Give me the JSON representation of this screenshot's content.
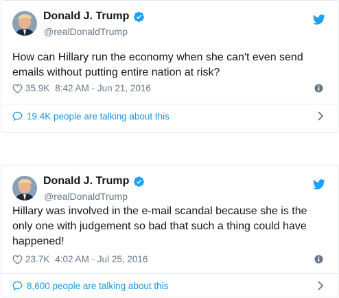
{
  "tweets": [
    {
      "name": "Donald J. Trump",
      "handle": "@realDonaldTrump",
      "text": "How can Hillary run the economy when she can't even send emails without putting entire nation at risk?",
      "likes": "35.9K",
      "time": "8:42 AM - Jun 21, 2016",
      "conversation": "19.4K people are talking about this"
    },
    {
      "name": "Donald J. Trump",
      "handle": "@realDonaldTrump",
      "text": "Hillary was involved in the e-mail scandal because she is the only one with judgement so bad that such a thing could have happened!",
      "likes": "23.7K",
      "time": "4:02 AM - Jul 25, 2016",
      "conversation": "8,600 people are talking about this"
    }
  ],
  "icons": {
    "verified": "verified-badge-icon",
    "twitter": "twitter-bird-icon",
    "like": "heart-icon",
    "info": "info-icon",
    "conversation": "speech-bubble-icon",
    "chevron": "chevron-right-icon"
  },
  "colors": {
    "twitter_blue": "#1da1f2",
    "link_blue": "#1b95e0",
    "secondary_text": "#657786",
    "primary_text": "#14171a",
    "border": "#e1e8ed"
  }
}
